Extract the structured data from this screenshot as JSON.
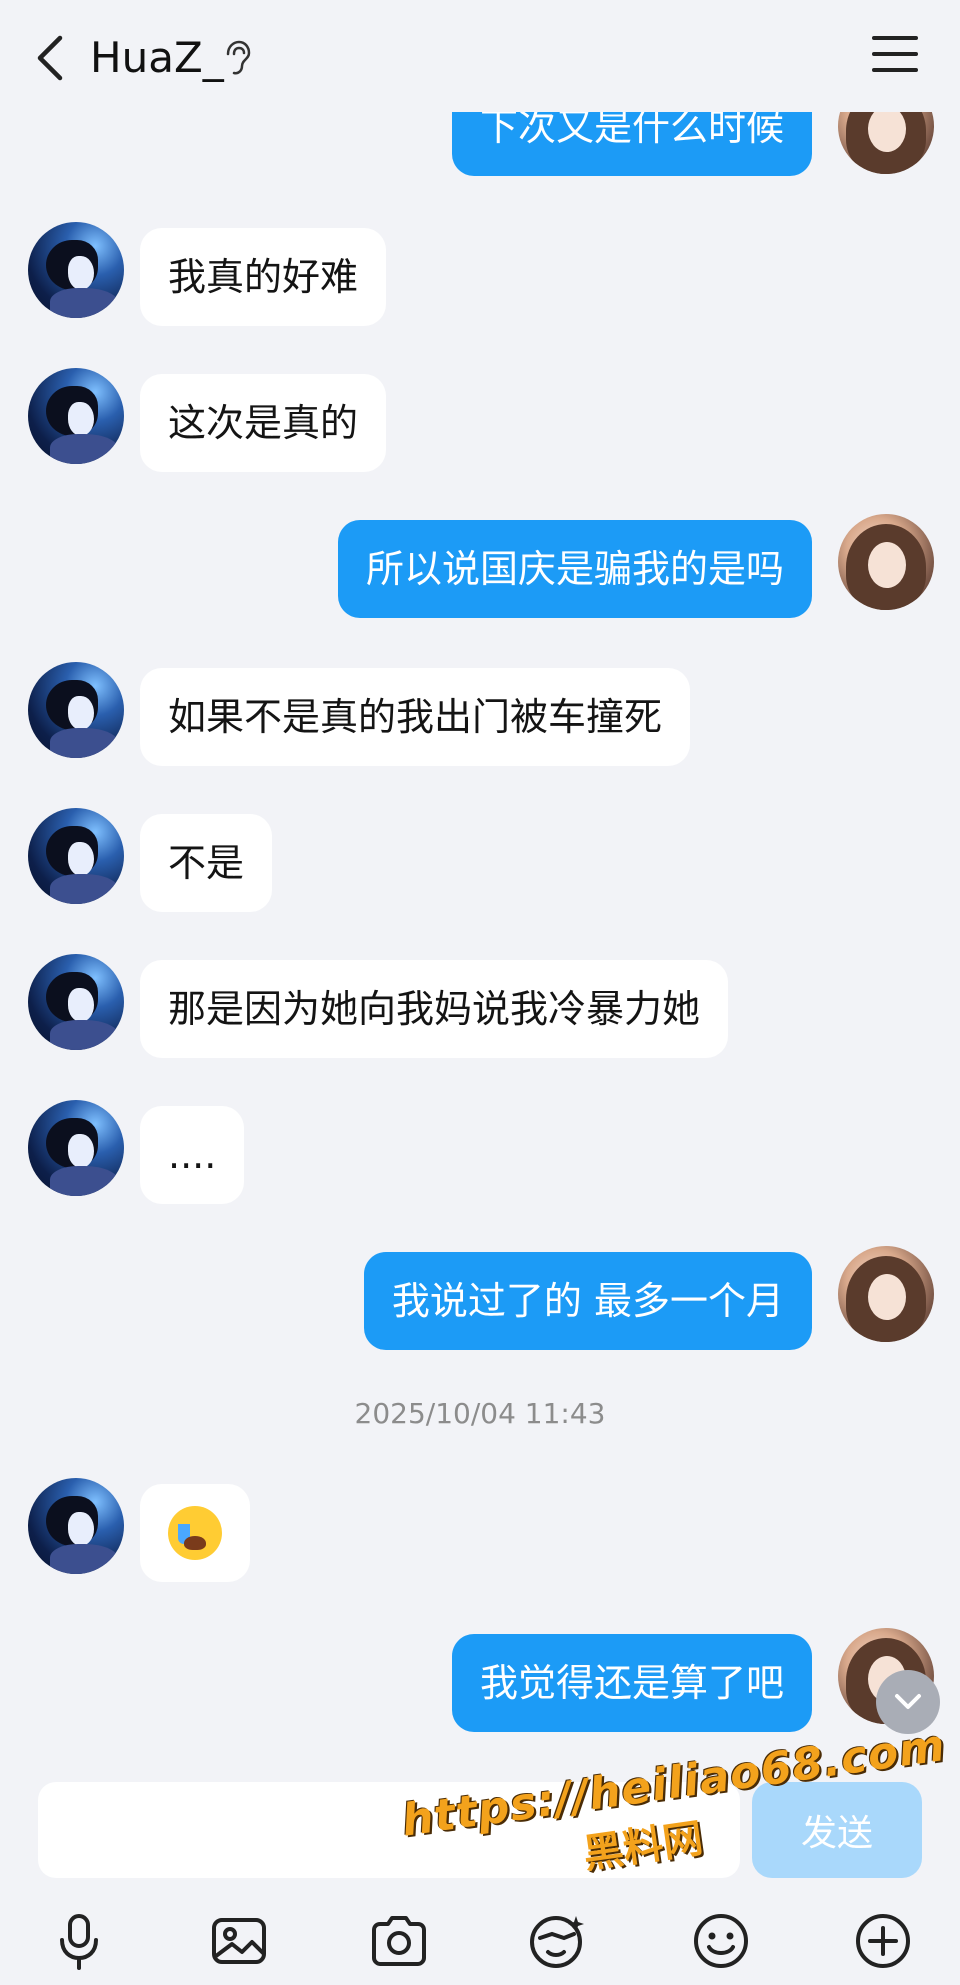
{
  "header": {
    "title": "HuaZ_"
  },
  "messages": [
    {
      "side": "right",
      "text": "下次又是什么时候"
    },
    {
      "side": "left",
      "text": "我真的好难"
    },
    {
      "side": "left",
      "text": "这次是真的"
    },
    {
      "side": "right",
      "text": "所以说国庆是骗我的是吗"
    },
    {
      "side": "left",
      "text": "如果不是真的我出门被车撞死"
    },
    {
      "side": "left",
      "text": "不是"
    },
    {
      "side": "left",
      "text": "那是因为她向我妈说我冷暴力她"
    },
    {
      "side": "left",
      "text": "...."
    },
    {
      "side": "right",
      "text": "我说过了的 最多一个月"
    },
    {
      "side": "left",
      "text": "",
      "emoji": "loudly-crying-face"
    },
    {
      "side": "right",
      "text": "我觉得还是算了吧"
    }
  ],
  "timestamp": "2025/10/04 11:43",
  "composer": {
    "placeholder": "",
    "send_label": "发送"
  },
  "toolbar": [
    "mic-icon",
    "image-icon",
    "camera-icon",
    "sticker-icon",
    "emoji-icon",
    "plus-icon"
  ],
  "watermark": {
    "url": "https://heiliao68.com",
    "brand": "黑料网"
  },
  "colors": {
    "background": "#f2f3f7",
    "sent_bubble": "#1c9bf6",
    "received_bubble": "#ffffff",
    "send_button": "#a9d8fb"
  }
}
